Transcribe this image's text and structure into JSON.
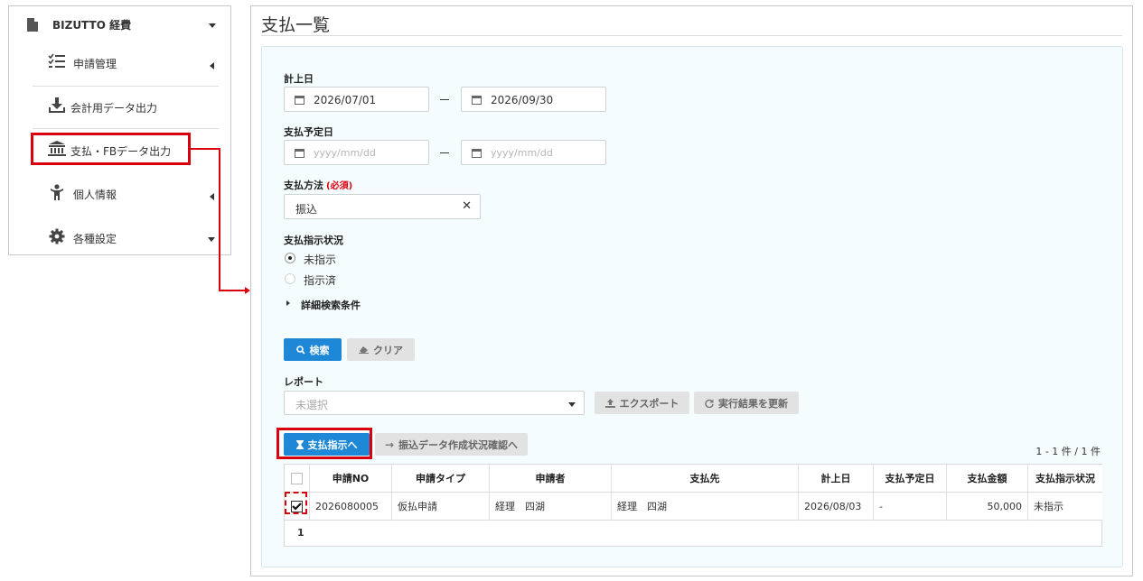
{
  "sidebar": {
    "title": "BIZUTTO 経費",
    "items": [
      {
        "label": "申請管理",
        "icon": "checklist-icon"
      },
      {
        "label": "会計用データ出力",
        "icon": "download-icon"
      },
      {
        "label": "支払・FBデータ出力",
        "icon": "bank-icon"
      },
      {
        "label": "個人情報",
        "icon": "person-icon"
      },
      {
        "label": "各種設定",
        "icon": "gear-icon"
      }
    ]
  },
  "page": {
    "title": "支払一覧"
  },
  "filters": {
    "record_date": {
      "label": "計上日",
      "from": "2026/07/01",
      "to": "2026/09/30"
    },
    "payment_date": {
      "label": "支払予定日",
      "from_placeholder": "yyyy/mm/dd",
      "to_placeholder": "yyyy/mm/dd"
    },
    "payment_method": {
      "label": "支払方法",
      "required": "(必須)",
      "value": "振込"
    },
    "instruction_status": {
      "label": "支払指示状況",
      "options": [
        "未指示",
        "指示済"
      ],
      "selected": "未指示"
    },
    "advanced": "詳細検索条件"
  },
  "actions": {
    "search": "検索",
    "clear": "クリア"
  },
  "report": {
    "label": "レポート",
    "placeholder": "未選択",
    "export": "エクスポート",
    "refresh": "実行結果を更新"
  },
  "table_actions": {
    "pay_instruct": "支払指示へ",
    "transfer_status": "振込データ作成状況確認へ",
    "count": "1 - 1 件 / 1 件"
  },
  "table": {
    "columns": [
      "申請NO",
      "申請タイプ",
      "申請者",
      "支払先",
      "計上日",
      "支払予定日",
      "支払金額",
      "支払指示状況"
    ],
    "rows": [
      {
        "no": "2026080005",
        "type": "仮払申請",
        "applicant": "経理　四湖",
        "payee": "経理　四湖",
        "record_date": "2026/08/03",
        "pay_date": "-",
        "amount": "50,000",
        "status": "未指示"
      }
    ],
    "page": "1"
  },
  "colors": {
    "accent": "#1e88d6",
    "highlight": "#d9000d",
    "panel": "#f5fcfd"
  }
}
